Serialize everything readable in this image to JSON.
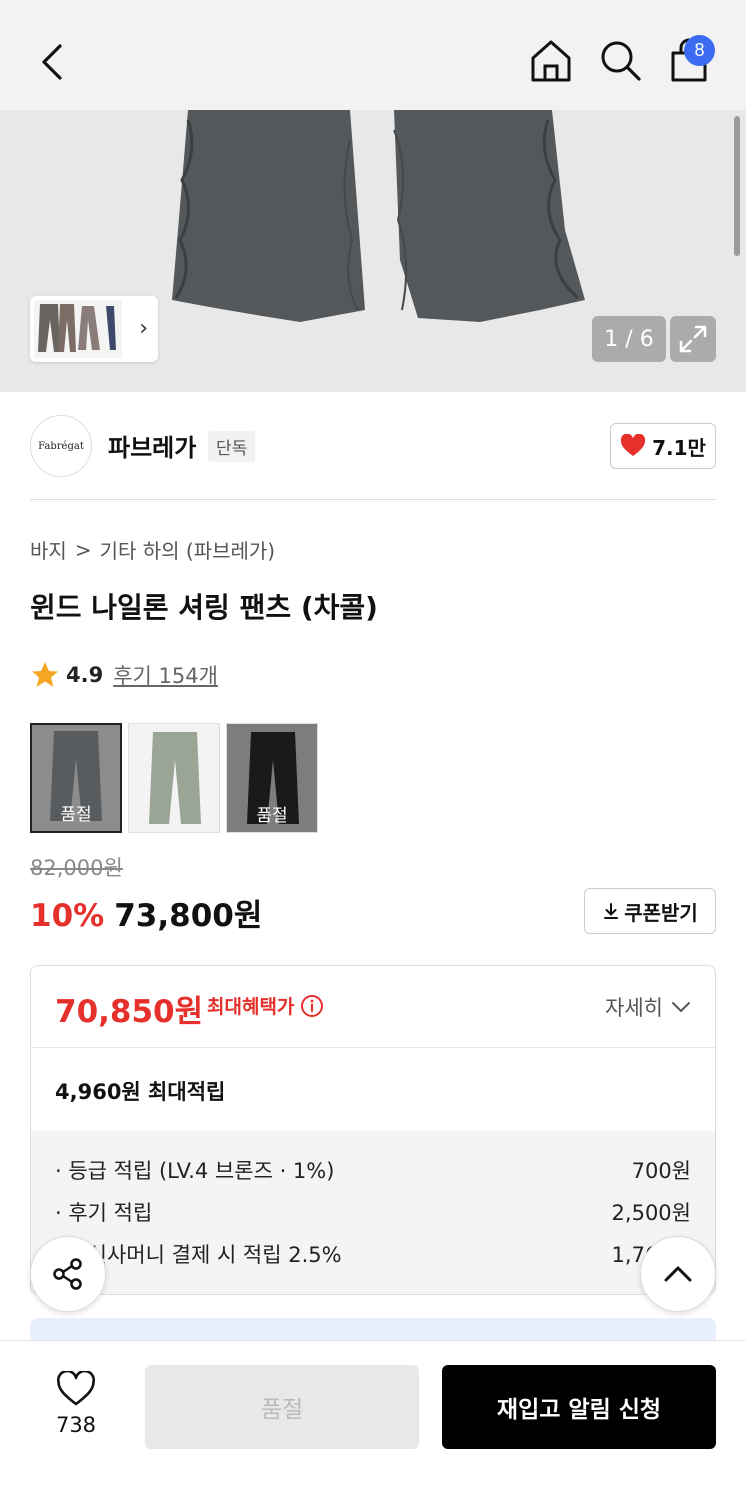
{
  "header": {
    "cart_count": "8",
    "icons": [
      "chevron-left-icon",
      "home-icon",
      "search-icon",
      "shopping-bag-icon"
    ]
  },
  "gallery": {
    "counter": "1 / 6",
    "thumb_arrow": "›"
  },
  "brand": {
    "logo_text": "Fabrégat",
    "name": "파브레가",
    "tag": "단독",
    "likes": "7.1만"
  },
  "breadcrumb": {
    "items": [
      "바지",
      "기타 하의 (파브레가)"
    ],
    "separator": ">"
  },
  "product": {
    "title": "윈드 나일론 셔링 팬츠 (차콜)",
    "rating": "4.9",
    "review_link": "후기 154개",
    "colors": [
      {
        "swatch": "#595c5f",
        "label": "품절",
        "selected": true
      },
      {
        "swatch": "#9aa596",
        "label": "",
        "selected": false
      },
      {
        "swatch": "#1a1a1a",
        "label": "품절",
        "selected": false
      }
    ],
    "original_price": "82,000원",
    "discount": "10%",
    "sale_price": "73,800원",
    "coupon_label": "쿠폰받기"
  },
  "benefit": {
    "max_price": "70,850원",
    "max_label": "최대혜택가",
    "detail_label": "자세히",
    "points_title": "4,960원 최대적립",
    "rows": [
      {
        "label": "· 등급 적립 (LV.4 브론즈 · 1%)",
        "value": "700원"
      },
      {
        "label": "· 후기 적립",
        "value": "2,500원"
      },
      {
        "label": "· 무신사머니 결제 시 적립 2.5%",
        "value": "1,760원"
      }
    ]
  },
  "bottom": {
    "wish_count": "738",
    "soldout_label": "품절",
    "restock_label": "재입고 알림 신청"
  },
  "colors": {
    "accent_red": "#e6302b",
    "badge_blue": "#3b6bf0"
  }
}
